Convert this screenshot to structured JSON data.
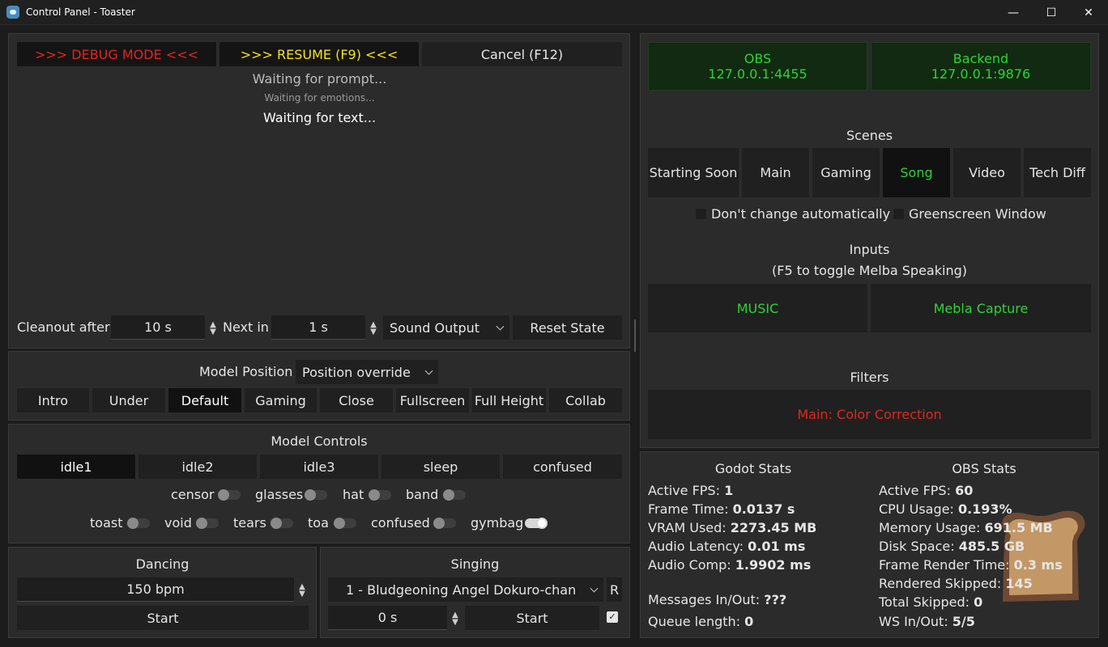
{
  "window": {
    "title": "Control Panel - Toaster",
    "minimize": "—",
    "maximize": "☐",
    "close": "✕"
  },
  "top_buttons": {
    "debug": ">>> DEBUG MODE <<<",
    "resume": ">>> RESUME (F9) <<<",
    "cancel": "Cancel (F12)"
  },
  "status": {
    "prompt": "Waiting for prompt...",
    "emotions": "Waiting for emotions...",
    "text": "Waiting for text..."
  },
  "cleanout": {
    "label": "Cleanout after",
    "value": "10 s",
    "next_label": "Next in",
    "next_value": "1 s",
    "sound_output": "Sound Output",
    "reset": "Reset State"
  },
  "model_position": {
    "label": "Model Position",
    "select": "Position override",
    "buttons": [
      "Intro",
      "Under",
      "Default",
      "Gaming",
      "Close",
      "Fullscreen",
      "Full Height",
      "Collab"
    ]
  },
  "model_controls": {
    "title": "Model Controls",
    "animations": [
      "idle1",
      "idle2",
      "idle3",
      "sleep",
      "confused"
    ],
    "toggles_row1": [
      "censor",
      "glasses",
      "hat",
      "band"
    ],
    "toggles_row2": [
      "toast",
      "void",
      "tears",
      "toa",
      "confused",
      "gymbag"
    ]
  },
  "dancing": {
    "title": "Dancing",
    "bpm": "150 bpm",
    "start": "Start"
  },
  "singing": {
    "title": "Singing",
    "song": "1 - Bludgeoning Angel Dokuro-chan",
    "r": "R",
    "time": "0 s",
    "start": "Start",
    "checked": true
  },
  "connections": {
    "obs_label": "OBS",
    "obs_addr": "127.0.0.1:4455",
    "backend_label": "Backend",
    "backend_addr": "127.0.0.1:9876"
  },
  "scenes": {
    "title": "Scenes",
    "items": [
      "Starting Soon",
      "Main",
      "Gaming",
      "Song",
      "Video",
      "Tech Diff"
    ],
    "active": "Song",
    "dont_change": "Don't change automatically",
    "greenscreen": "Greenscreen Window"
  },
  "inputs": {
    "title": "Inputs",
    "hint": "(F5 to toggle Melba Speaking)",
    "music": "MUSIC",
    "capture": "Mebla Capture"
  },
  "filters": {
    "title": "Filters",
    "item": "Main: Color Correction"
  },
  "godot_stats": {
    "title": "Godot Stats",
    "rows": [
      {
        "label": "Active FPS: ",
        "value": "1"
      },
      {
        "label": "Frame Time: ",
        "value": "0.0137 s"
      },
      {
        "label": "VRAM Used: ",
        "value": "2273.45 MB"
      },
      {
        "label": "Audio Latency: ",
        "value": "0.01 ms"
      },
      {
        "label": "Audio Comp: ",
        "value": "1.9902 ms"
      }
    ],
    "messages": {
      "label": "Messages In/Out: ",
      "value": "???"
    },
    "queue": {
      "label": "Queue length: ",
      "value": "0"
    }
  },
  "obs_stats": {
    "title": "OBS Stats",
    "rows": [
      {
        "label": "Active FPS: ",
        "value": "60"
      },
      {
        "label": "CPU Usage: ",
        "value": "0.193%"
      },
      {
        "label": "Memory Usage: ",
        "value": "691.5 MB"
      },
      {
        "label": "Disk Space: ",
        "value": "485.5 GB"
      },
      {
        "label": "Frame Render Time: ",
        "value": "0.3 ms"
      },
      {
        "label": "Rendered Skipped: ",
        "value": "145"
      },
      {
        "label": "Total Skipped: ",
        "value": "0"
      },
      {
        "label": "WS In/Out: ",
        "value": "5/5"
      }
    ]
  },
  "icons": {
    "app": "godot-icon",
    "toast": "toast-icon"
  },
  "colors": {
    "green": "#2ed335",
    "red": "#e0261d",
    "yellow": "#f5e31a"
  }
}
